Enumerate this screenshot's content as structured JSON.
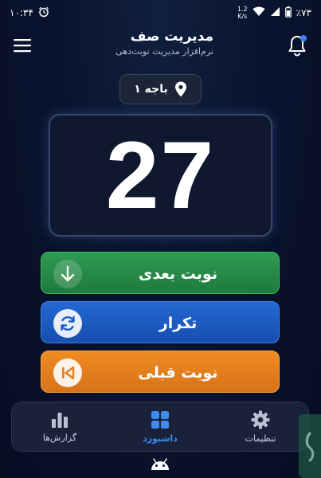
{
  "status_bar": {
    "time": "۱۰:۳۴",
    "net_speed_value": "1.2",
    "net_speed_unit": "K/s",
    "battery": "٪۷۳"
  },
  "header": {
    "title": "مدیریت صف",
    "subtitle": "نرم‌افزار مدیریت نوبت‌دهی"
  },
  "counter": {
    "label": "باجه ۱"
  },
  "queue": {
    "current_number": "27"
  },
  "actions": {
    "next_label": "نوبت بعدی",
    "repeat_label": "تکرار",
    "previous_label": "نوبت قبلی"
  },
  "bottom_nav": {
    "items": [
      {
        "label": "گزارش‌ها",
        "icon": "bar-chart-icon",
        "active": false
      },
      {
        "label": "داشبورد",
        "icon": "dashboard-grid-icon",
        "active": true
      },
      {
        "label": "تنظیمات",
        "icon": "gear-icon",
        "active": false
      }
    ]
  },
  "colors": {
    "background": "#0a1430",
    "next_button": "#2a8f4a",
    "repeat_button": "#1e5ec4",
    "previous_button": "#e57f1e",
    "active_nav": "#3e8cf2",
    "notification_dot": "#3b82f6"
  }
}
